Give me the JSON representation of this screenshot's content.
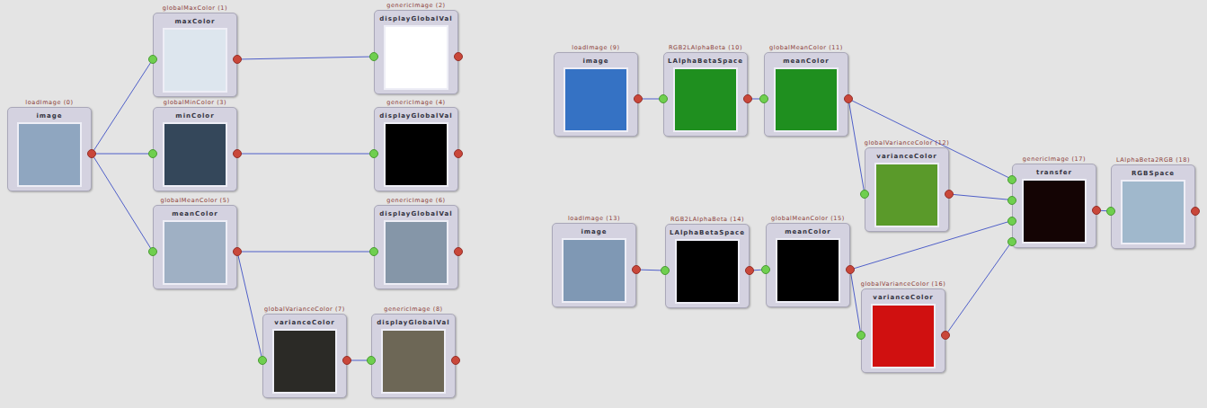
{
  "nodes": [
    {
      "caption": "loadImage (0)",
      "label": "image",
      "inputs": 0,
      "color": "#8fa6c0"
    },
    {
      "caption": "globalMaxColor (1)",
      "label": "maxColor",
      "inputs": 1,
      "color": "#dde6ee"
    },
    {
      "caption": "genericImage (2)",
      "label": "displayGlobalVal",
      "inputs": 1,
      "color": "#ffffff"
    },
    {
      "caption": "globalMinColor (3)",
      "label": "minColor",
      "inputs": 1,
      "color": "#34475a"
    },
    {
      "caption": "genericImage (4)",
      "label": "displayGlobalVal",
      "inputs": 1,
      "color": "#000000"
    },
    {
      "caption": "globalMeanColor (5)",
      "label": "meanColor",
      "inputs": 1,
      "color": "#9fb0c4"
    },
    {
      "caption": "genericImage (6)",
      "label": "displayGlobalVal",
      "inputs": 1,
      "color": "#8596a8"
    },
    {
      "caption": "globalVarianceColor (7)",
      "label": "varianceColor",
      "inputs": 1,
      "color": "#2b2a26"
    },
    {
      "caption": "genericImage (8)",
      "label": "displayGlobalVal",
      "inputs": 1,
      "color": "#6d6756"
    },
    {
      "caption": "loadImage (9)",
      "label": "image",
      "inputs": 0,
      "color": "#3572c4"
    },
    {
      "caption": "RGB2LAlphaBeta (10)",
      "label": "LAlphaBetaSpace",
      "inputs": 1,
      "color": "#1f8f1f"
    },
    {
      "caption": "globalMeanColor (11)",
      "label": "meanColor",
      "inputs": 1,
      "color": "#1f8f1f"
    },
    {
      "caption": "globalVarianceColor (12)",
      "label": "varianceColor",
      "inputs": 1,
      "color": "#5a9a2a"
    },
    {
      "caption": "loadImage (13)",
      "label": "image",
      "inputs": 0,
      "color": "#7f98b4"
    },
    {
      "caption": "RGB2LAlphaBeta (14)",
      "label": "LAlphaBetaSpace",
      "inputs": 1,
      "color": "#000000"
    },
    {
      "caption": "globalMeanColor (15)",
      "label": "meanColor",
      "inputs": 1,
      "color": "#000000"
    },
    {
      "caption": "globalVarianceColor (16)",
      "label": "varianceColor",
      "inputs": 1,
      "color": "#d01010"
    },
    {
      "caption": "genericImage (17)",
      "label": "transfer",
      "inputs": 4,
      "color": "#140404"
    },
    {
      "caption": "LAlphaBeta2RGB (18)",
      "label": "RGBSpace",
      "inputs": 1,
      "color": "#a0b8cc"
    }
  ],
  "edges": [
    {
      "from": 0,
      "to": 1,
      "port": 0
    },
    {
      "from": 0,
      "to": 3,
      "port": 0
    },
    {
      "from": 0,
      "to": 5,
      "port": 0
    },
    {
      "from": 1,
      "to": 2,
      "port": 0
    },
    {
      "from": 3,
      "to": 4,
      "port": 0
    },
    {
      "from": 5,
      "to": 6,
      "port": 0
    },
    {
      "from": 5,
      "to": 7,
      "port": 0
    },
    {
      "from": 7,
      "to": 8,
      "port": 0
    },
    {
      "from": 9,
      "to": 10,
      "port": 0
    },
    {
      "from": 10,
      "to": 11,
      "port": 0
    },
    {
      "from": 11,
      "to": 12,
      "port": 0
    },
    {
      "from": 11,
      "to": 17,
      "port": 0
    },
    {
      "from": 12,
      "to": 17,
      "port": 1
    },
    {
      "from": 15,
      "to": 17,
      "port": 2
    },
    {
      "from": 16,
      "to": 17,
      "port": 3
    },
    {
      "from": 13,
      "to": 14,
      "port": 0
    },
    {
      "from": 14,
      "to": 15,
      "port": 0
    },
    {
      "from": 15,
      "to": 16,
      "port": 0
    },
    {
      "from": 17,
      "to": 18,
      "port": 0
    }
  ]
}
